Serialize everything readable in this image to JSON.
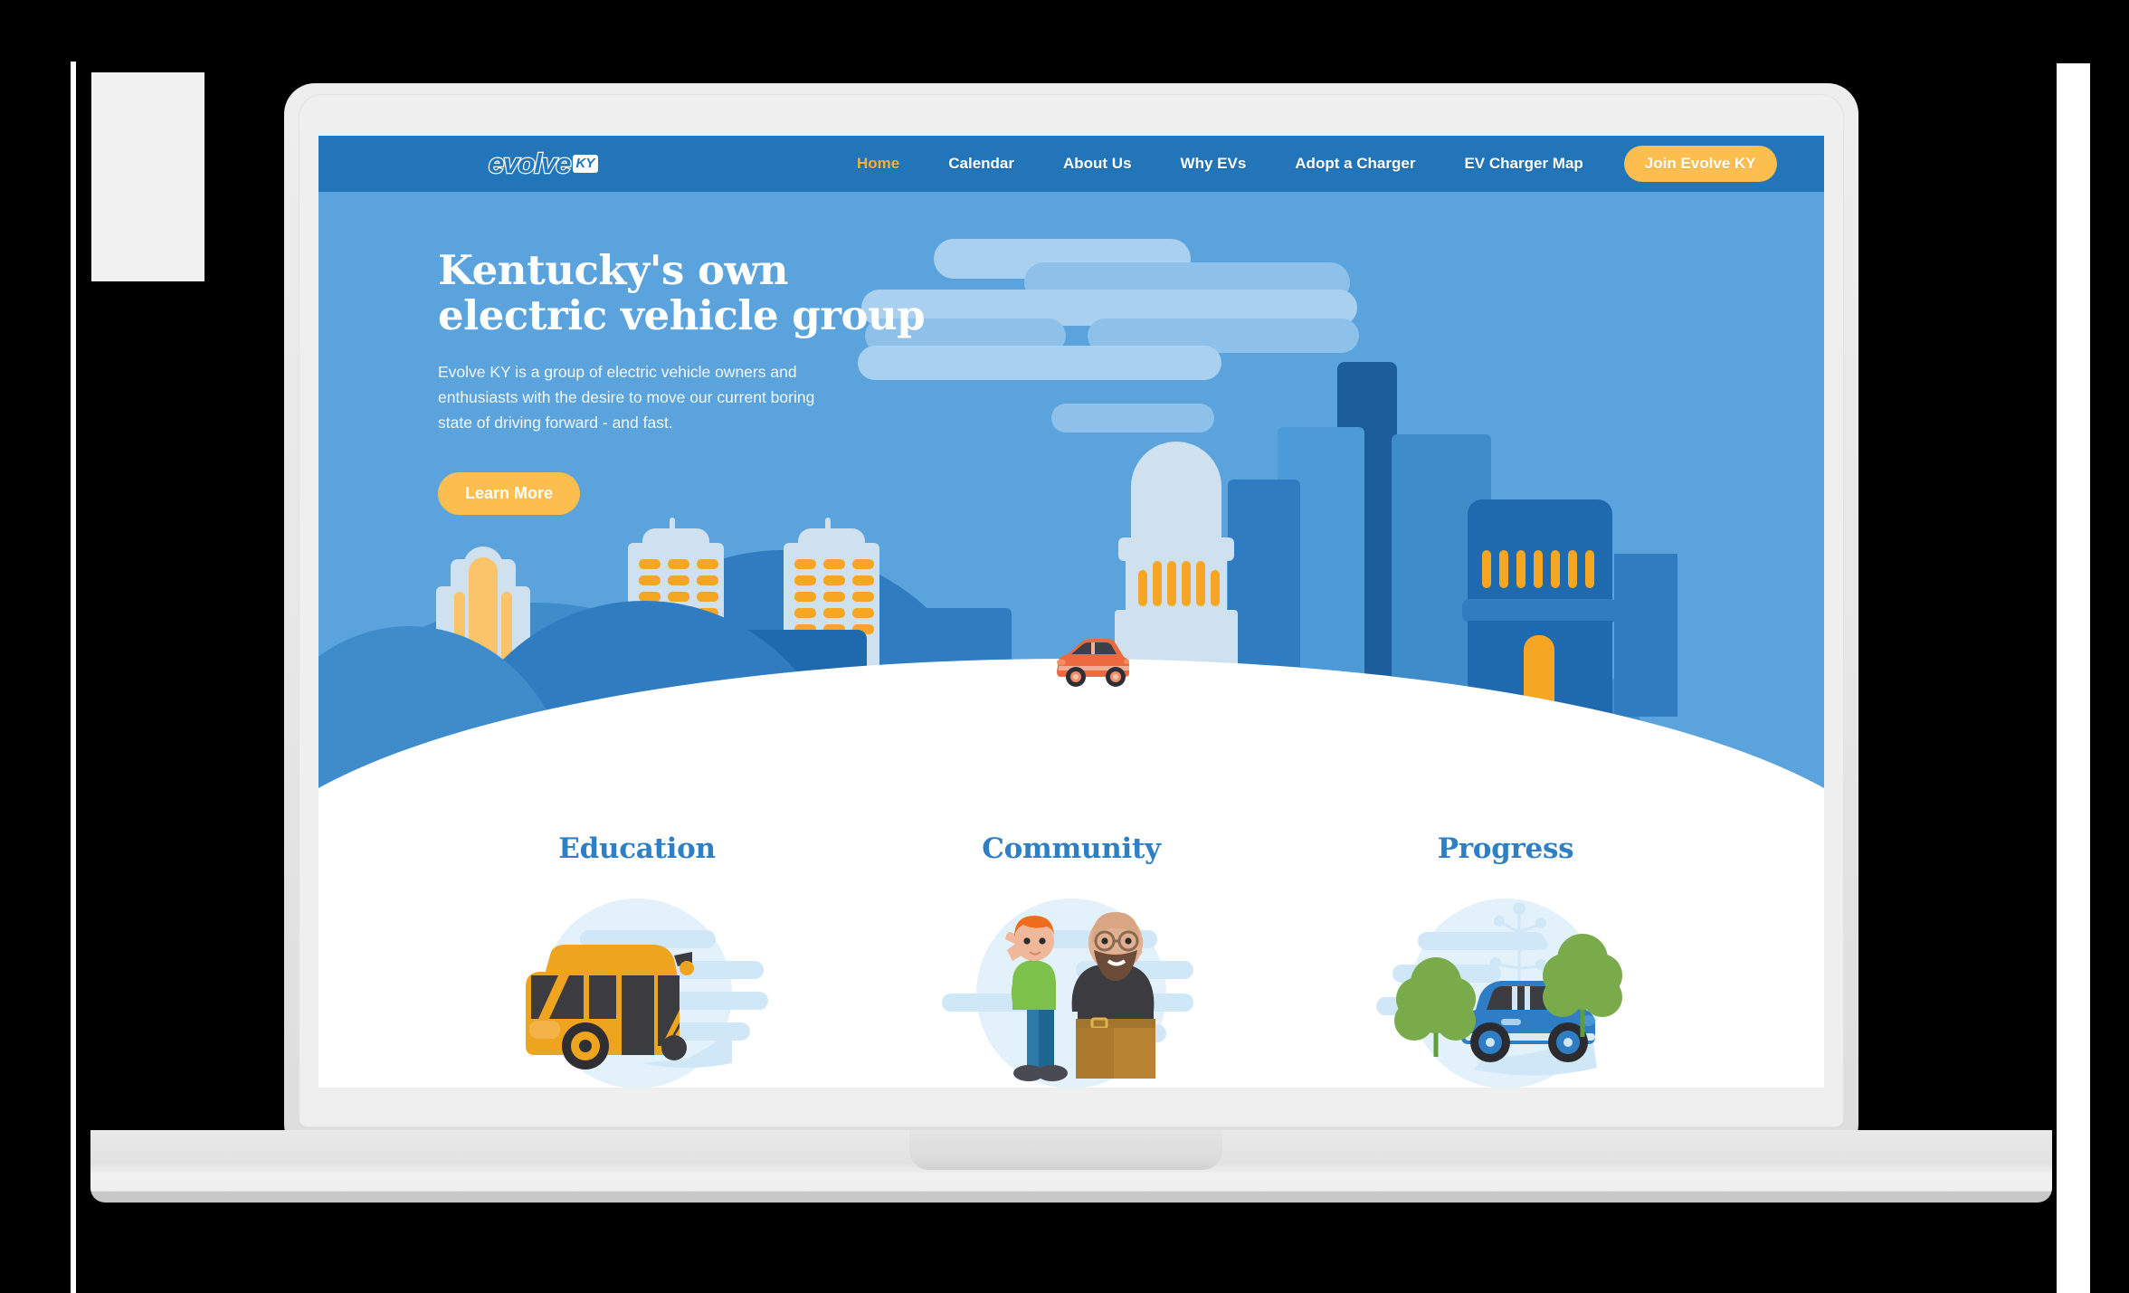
{
  "brand": {
    "logo_text": "evolve",
    "logo_badge": "KY",
    "primary_blue": "#2175b8",
    "hero_blue": "#5ba3dd",
    "accent_orange": "#fbbe4f",
    "heading_blue": "#2f7fc4"
  },
  "nav": {
    "items": [
      {
        "label": "Home",
        "active": true
      },
      {
        "label": "Calendar",
        "active": false
      },
      {
        "label": "About Us",
        "active": false
      },
      {
        "label": "Why EVs",
        "active": false
      },
      {
        "label": "Adopt a Charger",
        "active": false
      },
      {
        "label": "EV Charger Map",
        "active": false
      }
    ],
    "cta_label": "Join Evolve KY"
  },
  "hero": {
    "title": "Kentucky's own electric vehicle group",
    "subtitle": "Evolve KY is a group of electric vehicle owners and enthusiasts with the desire to move our current boring state of driving forward - and fast.",
    "button_label": "Learn More",
    "illustration": "louisville-skyline-with-electric-car"
  },
  "features": [
    {
      "title": "Education",
      "art": "electric-bus-illustration"
    },
    {
      "title": "Community",
      "art": "two-people-thumbs-up-illustration"
    },
    {
      "title": "Progress",
      "art": "electric-car-with-trees-illustration"
    }
  ],
  "device": {
    "type": "laptop-mockup"
  }
}
